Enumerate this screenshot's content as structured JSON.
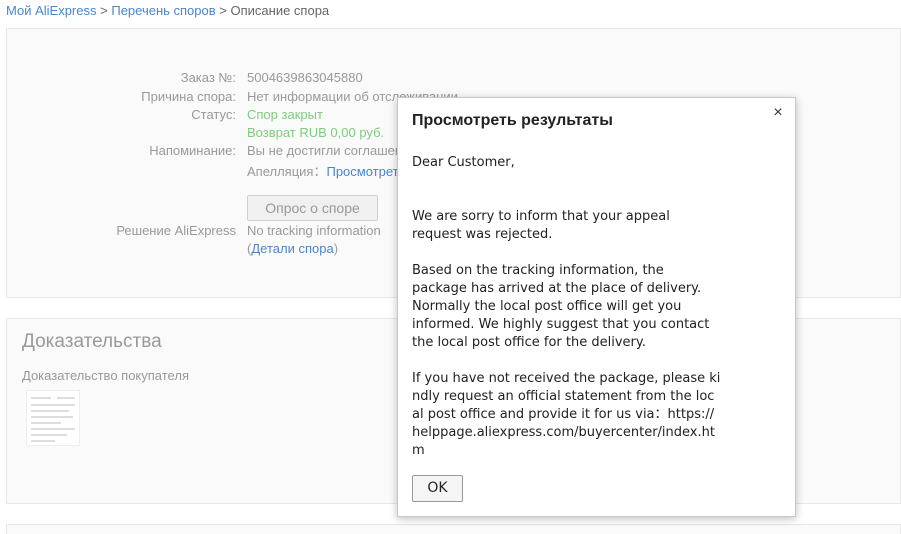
{
  "breadcrumb": {
    "items": [
      "Мой AliExpress",
      "Перечень споров",
      "Описание спора"
    ],
    "separator": ">"
  },
  "dispute": {
    "order_label": "Заказ №:",
    "order_value": "5004639863045880",
    "reason_label": "Причина спора:",
    "reason_value": "Нет информации об отслеживании",
    "status_label": "Статус:",
    "status_value": "Спор закрыт",
    "refund_value": "Возврат RUB 0,00 руб.",
    "reminder_label": "Напоминание:",
    "reminder_value": "Вы не достигли соглашения с продавцом. Спор был закрыт решением.",
    "appeal_label": "Апелляция：",
    "appeal_link": "Просмотреть результаты",
    "survey_button": "Опрос о споре",
    "decision_label": "Решение AliExpress",
    "decision_value": "No tracking information",
    "details_open": "(",
    "details_link": "Детали спора",
    "details_close": ")"
  },
  "evidence": {
    "title": "Доказательства",
    "buyer_label": "Доказательство покупателя"
  },
  "modal": {
    "title": "Просмотреть результаты",
    "close": "×",
    "greeting": "Dear Customer,",
    "p1": "We are sorry to inform that your appeal request was rejected.",
    "p2": "Based on the tracking information, the package has arrived at the place of delivery. Normally the local post office will get you informed. We highly suggest that you contact the local post office for the delivery.",
    "p3": "If you have not received the package, please kindly request an official statement from the local post office and provide it for us via：https://helppage.aliexpress.com/buyercenter/index.htm",
    "ok_button": "OK"
  },
  "colors": {
    "link": "#4a86c8",
    "success": "#7ccd7c",
    "muted": "#999999"
  }
}
